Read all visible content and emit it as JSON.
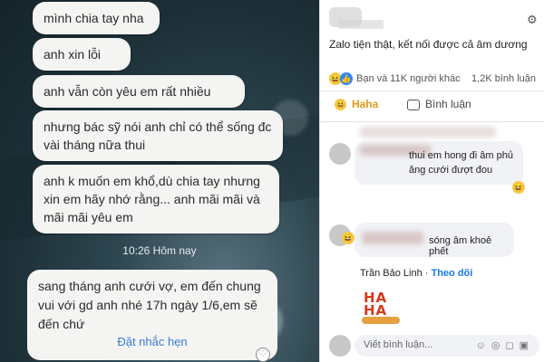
{
  "chat": {
    "messages": [
      "mình chia tay nha",
      "anh xin lỗi",
      "anh vẫn còn yêu em rất nhiều",
      "nhưng bác sỹ nói anh chỉ có thể sống đc vài tháng nữa thui",
      "anh k muốn em khổ,dù chia tay nhưng xin em hãy nhớ rằng... anh mãi mãi và mãi mãi yêu em"
    ],
    "timestamp": "10:26 Hôm nay",
    "reminder": {
      "text": "sang tháng anh cưới vợ, em đến chung vui với gd anh nhé 17h ngày 1/6,em sẽ đến chứ",
      "button_label": "Đặt nhắc hẹn"
    }
  },
  "post": {
    "text": "Zalo tiện thật, kết nối được cả âm dương",
    "reactions_label": "Bạn và 11K người khác",
    "comments_count": "1,2K bình luận",
    "haha_label": "Haha",
    "comment_label": "Bình luận"
  },
  "comments": [
    {
      "text": "thui em hong đi âm phủ ăng cưới đượt đou"
    },
    {
      "text": "sóng âm khoẻ phết"
    }
  ],
  "reply": {
    "name": "Trần Bảo Linh",
    "follow": "Theo dõi",
    "sticker_text": "HA HA"
  },
  "composer": {
    "placeholder": "Viết bình luận..."
  },
  "colors": {
    "accent": "#1877f2",
    "haha": "#e29a1a",
    "link": "#3a7bd5"
  }
}
